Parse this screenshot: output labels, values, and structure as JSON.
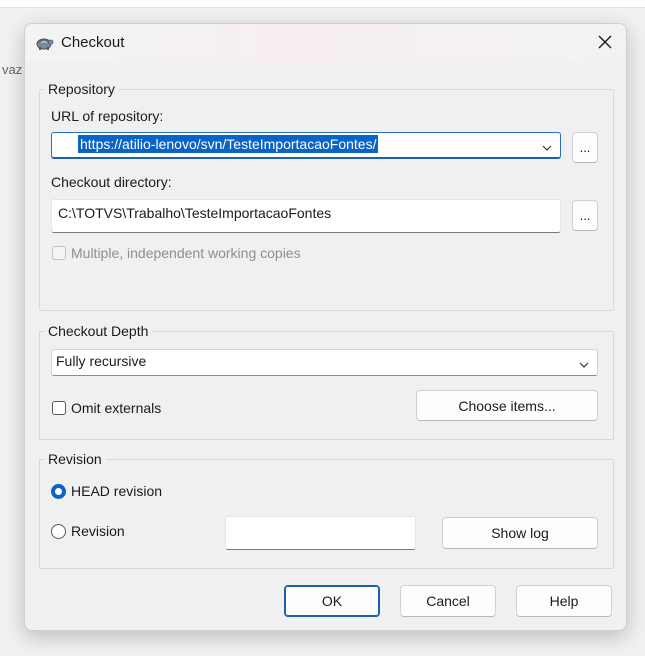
{
  "background": {
    "partial_text": "vaz"
  },
  "dialog": {
    "title": "Checkout",
    "icons": {
      "app": "tortoise-icon",
      "close": "close-icon"
    }
  },
  "repository": {
    "legend": "Repository",
    "url_label": "URL of repository:",
    "url_value": "https://atilio-lenovo/svn/TesteImportacaoFontes/",
    "url_browse": "...",
    "dir_label": "Checkout directory:",
    "dir_value": "C:\\TOTVS\\Trabalho\\TesteImportacaoFontes",
    "dir_browse": "...",
    "multiple_label": "Multiple, independent working copies",
    "multiple_checked": false,
    "multiple_enabled": false
  },
  "depth": {
    "legend": "Checkout Depth",
    "selected": "Fully recursive",
    "omit_label": "Omit externals",
    "omit_checked": false,
    "choose_items": "Choose items..."
  },
  "revision": {
    "legend": "Revision",
    "head_label": "HEAD revision",
    "head_selected": true,
    "revision_label": "Revision",
    "revision_value": "",
    "show_log": "Show log"
  },
  "buttons": {
    "ok": "OK",
    "cancel": "Cancel",
    "help": "Help"
  },
  "colors": {
    "accent": "#0a64c8",
    "selection": "#0a64c8",
    "background": "#f0f0f0"
  }
}
